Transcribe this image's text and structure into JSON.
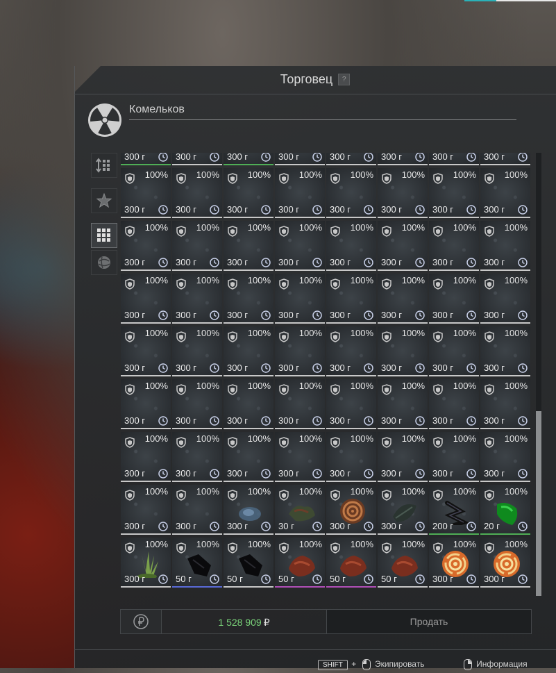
{
  "window": {
    "title": "Торговец",
    "help_label": "?"
  },
  "trader": {
    "name": "Комельков"
  },
  "sidebar": {
    "buttons": [
      {
        "icon": "sort-icon",
        "active": false
      },
      {
        "icon": "star-icon",
        "active": false
      },
      {
        "icon": "grid-icon",
        "active": true
      },
      {
        "icon": "sphere-icon",
        "active": false
      }
    ]
  },
  "grid": {
    "items": [
      {
        "pct": "",
        "price": "300 г",
        "quality": "green",
        "art": "stone"
      },
      {
        "pct": "",
        "price": "300 г",
        "quality": "white",
        "art": "stone"
      },
      {
        "pct": "",
        "price": "300 г",
        "quality": "green",
        "art": "stone"
      },
      {
        "pct": "",
        "price": "300 г",
        "quality": "white",
        "art": "stone"
      },
      {
        "pct": "",
        "price": "300 г",
        "quality": "white",
        "art": "stone"
      },
      {
        "pct": "",
        "price": "300 г",
        "quality": "white",
        "art": "stone"
      },
      {
        "pct": "",
        "price": "300 г",
        "quality": "white",
        "art": "stone"
      },
      {
        "pct": "",
        "price": "300 г",
        "quality": "white",
        "art": "stone"
      },
      {
        "pct": "100%",
        "price": "300 г",
        "quality": "white",
        "art": "stone"
      },
      {
        "pct": "100%",
        "price": "300 г",
        "quality": "white",
        "art": "stone"
      },
      {
        "pct": "100%",
        "price": "300 г",
        "quality": "white",
        "art": "stone"
      },
      {
        "pct": "100%",
        "price": "300 г",
        "quality": "white",
        "art": "stone"
      },
      {
        "pct": "100%",
        "price": "300 г",
        "quality": "white",
        "art": "stone"
      },
      {
        "pct": "100%",
        "price": "300 г",
        "quality": "white",
        "art": "stone"
      },
      {
        "pct": "100%",
        "price": "300 г",
        "quality": "white",
        "art": "stone"
      },
      {
        "pct": "100%",
        "price": "300 г",
        "quality": "white",
        "art": "stone"
      },
      {
        "pct": "100%",
        "price": "300 г",
        "quality": "white",
        "art": "stone"
      },
      {
        "pct": "100%",
        "price": "300 г",
        "quality": "white",
        "art": "stone"
      },
      {
        "pct": "100%",
        "price": "300 г",
        "quality": "white",
        "art": "stone"
      },
      {
        "pct": "100%",
        "price": "300 г",
        "quality": "white",
        "art": "stone"
      },
      {
        "pct": "100%",
        "price": "300 г",
        "quality": "white",
        "art": "stone"
      },
      {
        "pct": "100%",
        "price": "300 г",
        "quality": "white",
        "art": "stone"
      },
      {
        "pct": "100%",
        "price": "300 г",
        "quality": "white",
        "art": "stone"
      },
      {
        "pct": "100%",
        "price": "300 г",
        "quality": "white",
        "art": "stone"
      },
      {
        "pct": "100%",
        "price": "300 г",
        "quality": "white",
        "art": "stone"
      },
      {
        "pct": "100%",
        "price": "300 г",
        "quality": "white",
        "art": "stone"
      },
      {
        "pct": "100%",
        "price": "300 г",
        "quality": "white",
        "art": "stone"
      },
      {
        "pct": "100%",
        "price": "300 г",
        "quality": "white",
        "art": "stone"
      },
      {
        "pct": "100%",
        "price": "300 г",
        "quality": "white",
        "art": "stone"
      },
      {
        "pct": "100%",
        "price": "300 г",
        "quality": "white",
        "art": "stone"
      },
      {
        "pct": "100%",
        "price": "300 г",
        "quality": "white",
        "art": "stone"
      },
      {
        "pct": "100%",
        "price": "300 г",
        "quality": "white",
        "art": "stone"
      },
      {
        "pct": "100%",
        "price": "300 г",
        "quality": "white",
        "art": "stone"
      },
      {
        "pct": "100%",
        "price": "300 г",
        "quality": "white",
        "art": "stone"
      },
      {
        "pct": "100%",
        "price": "300 г",
        "quality": "white",
        "art": "stone"
      },
      {
        "pct": "100%",
        "price": "300 г",
        "quality": "white",
        "art": "stone"
      },
      {
        "pct": "100%",
        "price": "300 г",
        "quality": "white",
        "art": "stone"
      },
      {
        "pct": "100%",
        "price": "300 г",
        "quality": "white",
        "art": "stone"
      },
      {
        "pct": "100%",
        "price": "300 г",
        "quality": "white",
        "art": "stone"
      },
      {
        "pct": "100%",
        "price": "300 г",
        "quality": "white",
        "art": "stone"
      },
      {
        "pct": "100%",
        "price": "300 г",
        "quality": "white",
        "art": "stone"
      },
      {
        "pct": "100%",
        "price": "300 г",
        "quality": "white",
        "art": "stone"
      },
      {
        "pct": "100%",
        "price": "300 г",
        "quality": "white",
        "art": "stone"
      },
      {
        "pct": "100%",
        "price": "300 г",
        "quality": "white",
        "art": "stone"
      },
      {
        "pct": "100%",
        "price": "300 г",
        "quality": "white",
        "art": "stone"
      },
      {
        "pct": "100%",
        "price": "300 г",
        "quality": "white",
        "art": "stone"
      },
      {
        "pct": "100%",
        "price": "300 г",
        "quality": "white",
        "art": "stone"
      },
      {
        "pct": "100%",
        "price": "300 г",
        "quality": "white",
        "art": "stone"
      },
      {
        "pct": "100%",
        "price": "300 г",
        "quality": "white",
        "art": "stone"
      },
      {
        "pct": "100%",
        "price": "300 г",
        "quality": "white",
        "art": "stone"
      },
      {
        "pct": "100%",
        "price": "300 г",
        "quality": "white",
        "art": "stone"
      },
      {
        "pct": "100%",
        "price": "300 г",
        "quality": "white",
        "art": "stone"
      },
      {
        "pct": "100%",
        "price": "300 г",
        "quality": "white",
        "art": "stone"
      },
      {
        "pct": "100%",
        "price": "300 г",
        "quality": "white",
        "art": "stone"
      },
      {
        "pct": "100%",
        "price": "300 г",
        "quality": "white",
        "art": "stone"
      },
      {
        "pct": "100%",
        "price": "300 г",
        "quality": "white",
        "art": "stone"
      },
      {
        "pct": "100%",
        "price": "300 г",
        "quality": "white",
        "art": "stone"
      },
      {
        "pct": "100%",
        "price": "300 г",
        "quality": "white",
        "art": "stone"
      },
      {
        "pct": "100%",
        "price": "300 г",
        "quality": "white",
        "art": "blue-stone"
      },
      {
        "pct": "100%",
        "price": "30 г",
        "quality": "white",
        "art": "moss"
      },
      {
        "pct": "100%",
        "price": "300 г",
        "quality": "white",
        "art": "coil"
      },
      {
        "pct": "100%",
        "price": "300 г",
        "quality": "white",
        "art": "dark-leaf"
      },
      {
        "pct": "100%",
        "price": "200 г",
        "quality": "green",
        "art": "thorn"
      },
      {
        "pct": "100%",
        "price": "20 г",
        "quality": "green",
        "art": "green-gem"
      },
      {
        "pct": "100%",
        "price": "300 г",
        "quality": "white",
        "art": "grass"
      },
      {
        "pct": "100%",
        "price": "50 г",
        "quality": "blue",
        "art": "black-crystal"
      },
      {
        "pct": "100%",
        "price": "50 г",
        "quality": "white",
        "art": "black-crystal"
      },
      {
        "pct": "100%",
        "price": "50 г",
        "quality": "purple",
        "art": "red-rock"
      },
      {
        "pct": "100%",
        "price": "50 г",
        "quality": "purple",
        "art": "red-rock"
      },
      {
        "pct": "100%",
        "price": "50 г",
        "quality": "white",
        "art": "red-rock"
      },
      {
        "pct": "100%",
        "price": "300 г",
        "quality": "white",
        "art": "spiral"
      },
      {
        "pct": "100%",
        "price": "300 г",
        "quality": "white",
        "art": "spiral"
      }
    ]
  },
  "footer": {
    "balance": "1 528 909",
    "currency": "₽",
    "sell_label": "Продать"
  },
  "hints": {
    "shift_key": "SHIFT",
    "plus": "+",
    "equip_label": "Экипировать",
    "info_label": "Информация"
  },
  "colors": {
    "balance": "#7ad37a",
    "quality_white": "#c8c8c8",
    "quality_green": "#4fae56",
    "quality_blue": "#5a6bd8",
    "quality_purple": "#b14fb8",
    "accent": "#2ab1b8"
  }
}
